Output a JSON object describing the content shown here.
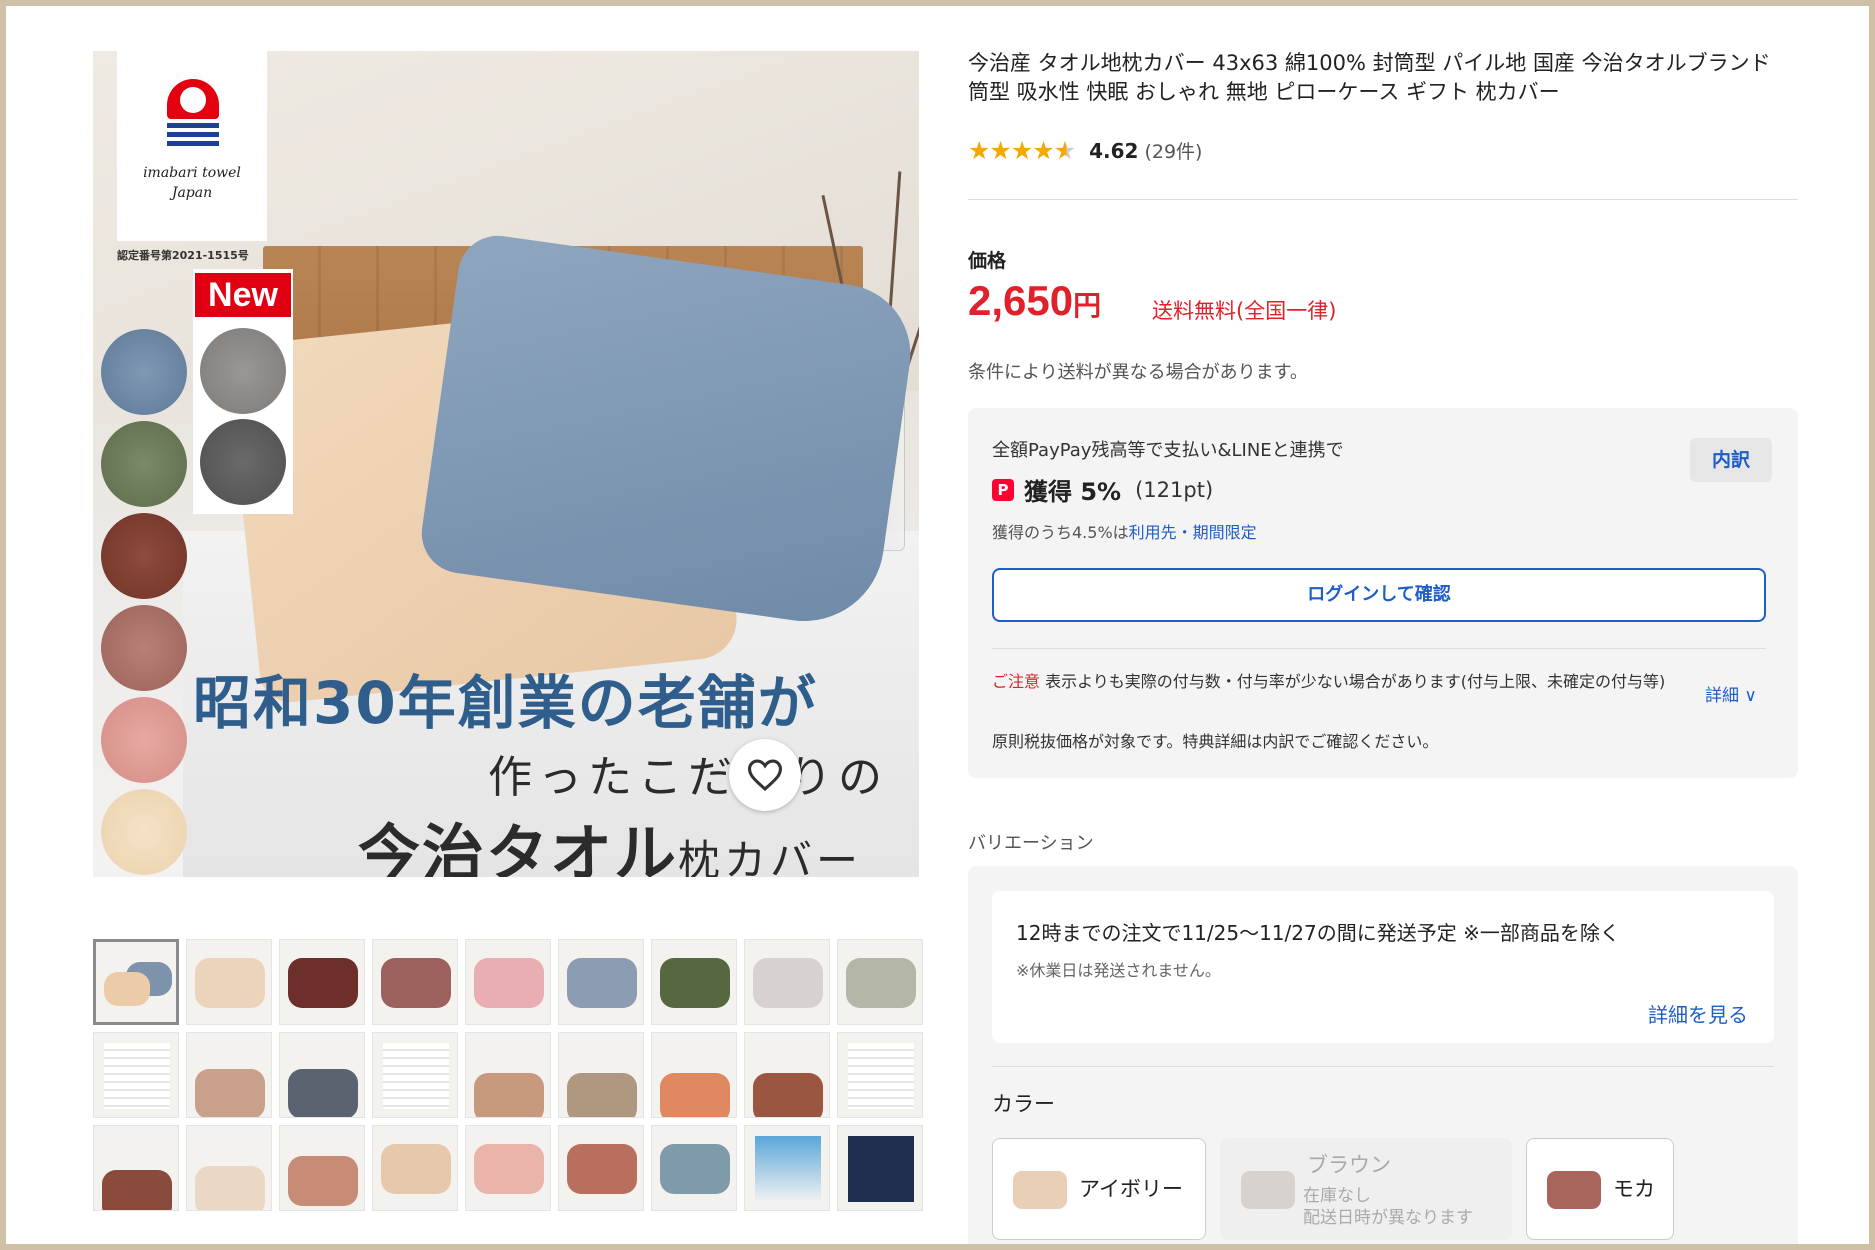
{
  "product": {
    "title": "今治産 タオル地枕カバー 43x63 綿100% 封筒型 パイル地 国産 今治タオルブランド 筒型 吸水性 快眠 おしゃれ 無地 ピローケース ギフト 枕カバー",
    "rating": 4.62,
    "rating_display": "4.62",
    "review_count": "(29件)",
    "price_label": "価格",
    "price": "2,650",
    "price_unit": "円",
    "shipping": "送料無料(全国一律)",
    "shipping_note": "条件により送料が異なる場合があります。"
  },
  "main_image": {
    "logo_text_1": "imabari towel",
    "logo_text_2": "Japan",
    "cert": "認定番号第2021-1515号",
    "badge": "New",
    "copy_1": "昭和30年創業の老舗が",
    "copy_2": "作ったこだわりの",
    "copy_3": "今治タオル",
    "copy_3_small": "枕カバー",
    "favorite_icon": "heart-icon"
  },
  "points": {
    "line1": "全額PayPay残高等で支払い&LINEと連携で",
    "icon_letter": "P",
    "earn": "獲得 5%",
    "pt": "(121pt)",
    "line3_prefix": "獲得のうち4.5%は",
    "line3_link": "利用先・期間限定",
    "breakdown": "内訳",
    "login_button": "ログインして確認",
    "notice_label": "ご注意",
    "notice_text": " 表示よりも実際の付与数・付与率が少ない場合があります(付与上限、未確定の付与等)",
    "notice_link": "詳細 ∨",
    "notice_2": "原則税抜価格が対象です。特典詳細は内訳でご確認ください。"
  },
  "variation": {
    "label": "バリエーション",
    "ship_main": "12時までの注文で11/25〜11/27の間に発送予定 ※一部商品を除く",
    "ship_sub": "※休業日は発送されません。",
    "ship_link": "詳細を見る",
    "color_label": "カラー",
    "colors": [
      {
        "name": "アイボリー",
        "swatch": "#e8cfb6"
      },
      {
        "name": "ブラウン",
        "swatch": "#d8d2ce",
        "status": "在庫なし",
        "note": "配送日時が異なります"
      },
      {
        "name": "モカ",
        "swatch": "#a9645c"
      }
    ]
  },
  "colors": {
    "price_red": "#e0212b",
    "link_blue": "#1d5ec9",
    "star": "#f5a800"
  }
}
